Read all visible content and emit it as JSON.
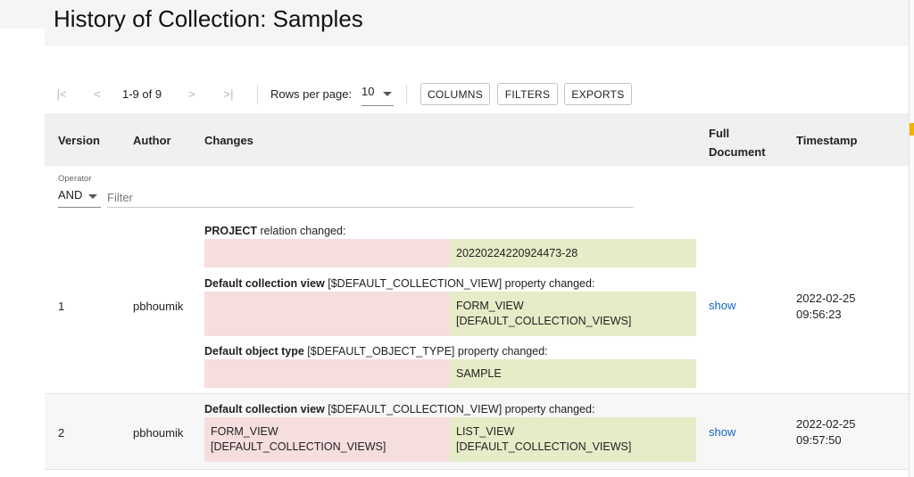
{
  "page": {
    "title": "History of Collection: Samples"
  },
  "toolbar": {
    "first_page_icon": "first-page-icon",
    "prev_page_icon": "prev-page-icon",
    "next_page_icon": "next-page-icon",
    "last_page_icon": "last-page-icon",
    "first_glyph": "|<",
    "prev_glyph": "<",
    "next_glyph": ">",
    "last_glyph": ">|",
    "page_info": "1-9 of 9",
    "rows_per_page_label": "Rows per page:",
    "rows_per_page_value": "10",
    "columns_label": "COLUMNS",
    "filters_label": "FILTERS",
    "exports_label": "EXPORTS"
  },
  "columns": {
    "version": "Version",
    "author": "Author",
    "changes": "Changes",
    "full_document_1": "Full",
    "full_document_2": "Document",
    "timestamp": "Timestamp"
  },
  "filter_row": {
    "operator_label": "Operator",
    "operator_value": "AND",
    "filter_placeholder": "Filter"
  },
  "rows": [
    {
      "version": "1",
      "author": "pbhoumik",
      "show": "show",
      "timestamp_date": "2022-02-25",
      "timestamp_time": "09:56:23",
      "changes": [
        {
          "head_bold": "PROJECT",
          "head_rest": " relation changed:",
          "old": "",
          "new": "20220224220924473-28"
        },
        {
          "head_bold": "Default collection view",
          "head_rest": " [$DEFAULT_COLLECTION_VIEW] property changed:",
          "old": "",
          "new_line1": "FORM_VIEW",
          "new_line2": "[DEFAULT_COLLECTION_VIEWS]"
        },
        {
          "head_bold": "Default object type",
          "head_rest": " [$DEFAULT_OBJECT_TYPE] property changed:",
          "old": "",
          "new": "SAMPLE"
        }
      ]
    },
    {
      "version": "2",
      "author": "pbhoumik",
      "show": "show",
      "timestamp_date": "2022-02-25",
      "timestamp_time": "09:57:50",
      "changes": [
        {
          "head_bold": "Default collection view",
          "head_rest": " [$DEFAULT_COLLECTION_VIEW] property changed:",
          "old_line1": "FORM_VIEW",
          "old_line2": "[DEFAULT_COLLECTION_VIEWS]",
          "new_line1": "LIST_VIEW",
          "new_line2": "[DEFAULT_COLLECTION_VIEWS]"
        }
      ]
    }
  ],
  "colors": {
    "diff_removed_bg": "#f6dede",
    "diff_added_bg": "#e6ecc7",
    "link": "#1565c0",
    "header_bg": "#f0f0f0"
  }
}
